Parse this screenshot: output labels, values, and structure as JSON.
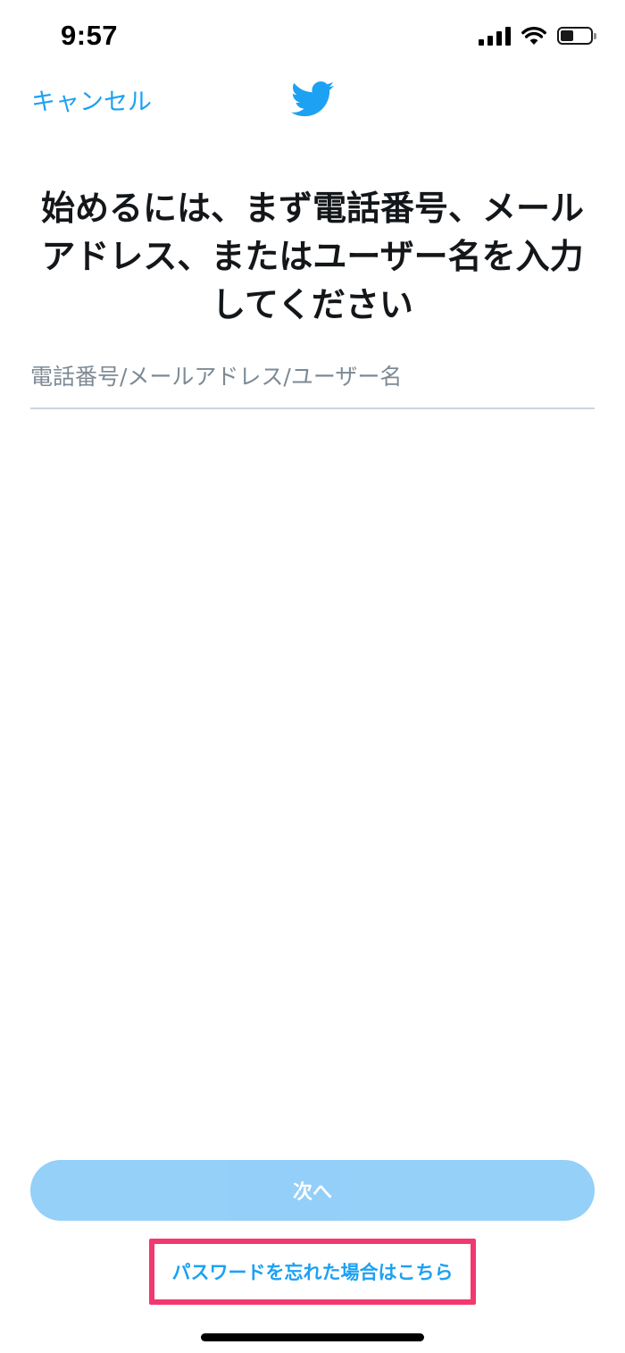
{
  "status_bar": {
    "time": "9:57",
    "icons": [
      "cellular-signal-icon",
      "wifi-icon",
      "battery-icon"
    ],
    "battery_level": 0.45
  },
  "header": {
    "cancel_label": "キャンセル",
    "logo_icon": "twitter-bird-icon"
  },
  "main": {
    "title": "始めるには、まず電話番号、メールアドレス、またはユーザー名を入力してください",
    "identifier_input": {
      "value": "",
      "placeholder": "電話番号/メールアドレス/ユーザー名"
    }
  },
  "footer": {
    "next_label": "次へ",
    "forgot_password_label": "パスワードを忘れた場合はこちら"
  },
  "colors": {
    "accent": "#1da1f2",
    "button_disabled": "#8ecdf8",
    "highlight": "#f2386f"
  }
}
